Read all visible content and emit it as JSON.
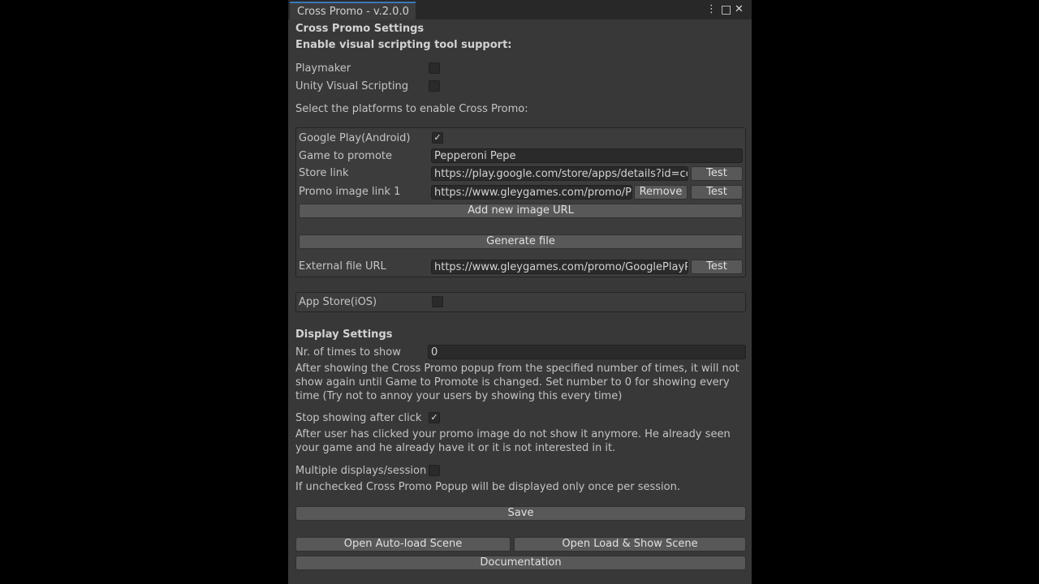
{
  "window": {
    "tab_title": "Cross Promo - v.2.0.0",
    "menu_icon": "⋮",
    "maximize_icon": "□",
    "close_icon": "✕"
  },
  "header": {
    "title": "Cross Promo Settings",
    "visual_scripting_label": "Enable visual scripting tool support:"
  },
  "visual_scripting": {
    "playmaker_label": "Playmaker",
    "playmaker_checked": false,
    "unity_vs_label": "Unity Visual Scripting",
    "unity_vs_checked": false
  },
  "platforms_label": "Select the platforms to enable Cross Promo:",
  "google_play": {
    "label": "Google Play(Android)",
    "checked": true,
    "check_glyph": "✓",
    "game_label": "Game to promote",
    "game_value": "Pepperoni Pepe",
    "store_label": "Store link",
    "store_value": "https://play.google.com/store/apps/details?id=com.",
    "promo_label": "Promo image link 1",
    "promo_value": "https://www.gleygames.com/promo/Pro",
    "remove_label": "Remove",
    "test_label": "Test",
    "add_image_label": "Add new image URL",
    "generate_label": "Generate file",
    "external_label": "External file URL",
    "external_value": "https://www.gleygames.com/promo/GooglePlayPrc"
  },
  "app_store": {
    "label": "App Store(iOS)",
    "checked": false
  },
  "display": {
    "title": "Display Settings",
    "times_label": "Nr. of times to show",
    "times_value": "0",
    "times_help": "After showing the Cross Promo popup from the specified number of times, it will not show again until Game to Promote is changed. Set number to 0 for showing every time (Try not to annoy your users by showing this every time)",
    "stop_label": "Stop showing after click",
    "stop_checked": true,
    "check_glyph": "✓",
    "stop_help": "After user has clicked your promo image do not show it anymore. He already seen your game and he already have it or it is not interested in it.",
    "multiple_label": "Multiple displays/session",
    "multiple_checked": false,
    "multiple_help": "If unchecked Cross Promo Popup will be displayed only once per session."
  },
  "buttons": {
    "save": "Save",
    "auto_load": "Open Auto-load Scene",
    "load_show": "Open Load & Show Scene",
    "documentation": "Documentation"
  }
}
